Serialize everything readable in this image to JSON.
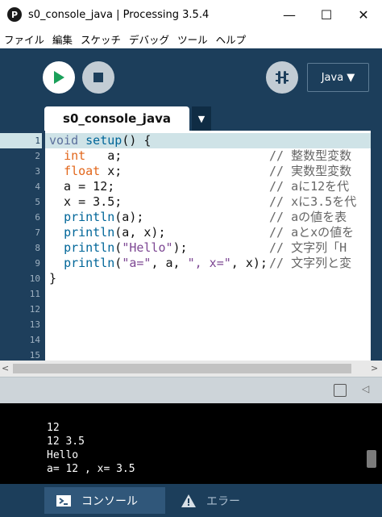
{
  "window": {
    "app_icon": "P",
    "title": "s0_console_java | Processing 3.5.4",
    "minimize": "—",
    "maximize": "☐",
    "close": "✕"
  },
  "menu": [
    "ファイル",
    "編集",
    "スケッチ",
    "デバッグ",
    "ツール",
    "ヘルプ"
  ],
  "toolbar": {
    "mode": "Java ▼",
    "run_icon": "play-icon",
    "stop_icon": "stop-icon",
    "debug_icon": "debugger-icon"
  },
  "tabs": {
    "active": "s0_console_java",
    "menu_arrow": "▼"
  },
  "editor": {
    "line_numbers": [
      "1",
      "2",
      "3",
      "4",
      "5",
      "6",
      "7",
      "8",
      "9",
      "10",
      "11",
      "12",
      "13",
      "14",
      "15"
    ],
    "code": [
      [
        {
          "t": "void ",
          "c": "kw1"
        },
        {
          "t": "setup",
          "c": "fn"
        },
        {
          "t": "() {",
          "c": ""
        }
      ],
      [
        {
          "t": "  ",
          "c": ""
        },
        {
          "t": "int",
          "c": "kw2"
        },
        {
          "t": "   a;",
          "c": ""
        }
      ],
      [
        {
          "t": "  ",
          "c": ""
        },
        {
          "t": "float",
          "c": "kw2"
        },
        {
          "t": " x;",
          "c": ""
        }
      ],
      [
        {
          "t": "  a = 12;",
          "c": ""
        }
      ],
      [
        {
          "t": "  x = 3.5;",
          "c": ""
        }
      ],
      [
        {
          "t": "  ",
          "c": ""
        },
        {
          "t": "println",
          "c": "fn"
        },
        {
          "t": "(a);",
          "c": ""
        }
      ],
      [
        {
          "t": "  ",
          "c": ""
        },
        {
          "t": "println",
          "c": "fn"
        },
        {
          "t": "(a, x);",
          "c": ""
        }
      ],
      [
        {
          "t": "  ",
          "c": ""
        },
        {
          "t": "println",
          "c": "fn"
        },
        {
          "t": "(",
          "c": ""
        },
        {
          "t": "\"Hello\"",
          "c": "str"
        },
        {
          "t": ");",
          "c": ""
        }
      ],
      [
        {
          "t": "  ",
          "c": ""
        },
        {
          "t": "println",
          "c": "fn"
        },
        {
          "t": "(",
          "c": ""
        },
        {
          "t": "\"a=\"",
          "c": "str"
        },
        {
          "t": ", a, ",
          "c": ""
        },
        {
          "t": "\", x=\"",
          "c": "str"
        },
        {
          "t": ", x);",
          "c": ""
        }
      ],
      [
        {
          "t": "}",
          "c": ""
        }
      ]
    ],
    "comments": [
      "",
      "// 整数型変数",
      "// 実数型変数",
      "// aに12を代",
      "// xに3.5を代",
      "// aの値を表",
      "// aとxの値を",
      "// 文字列「H",
      "// 文字列と変"
    ]
  },
  "scrollbar": {
    "left_arrow": "<",
    "right_arrow": ">"
  },
  "console_header": {
    "copy_icon": "copy-icon",
    "collapse_icon": "◁"
  },
  "console": {
    "lines": [
      "12",
      "12 3.5",
      "Hello",
      "a= 12 , x= 3.5"
    ]
  },
  "status_tabs": {
    "console": "コンソール",
    "errors": "エラー"
  }
}
